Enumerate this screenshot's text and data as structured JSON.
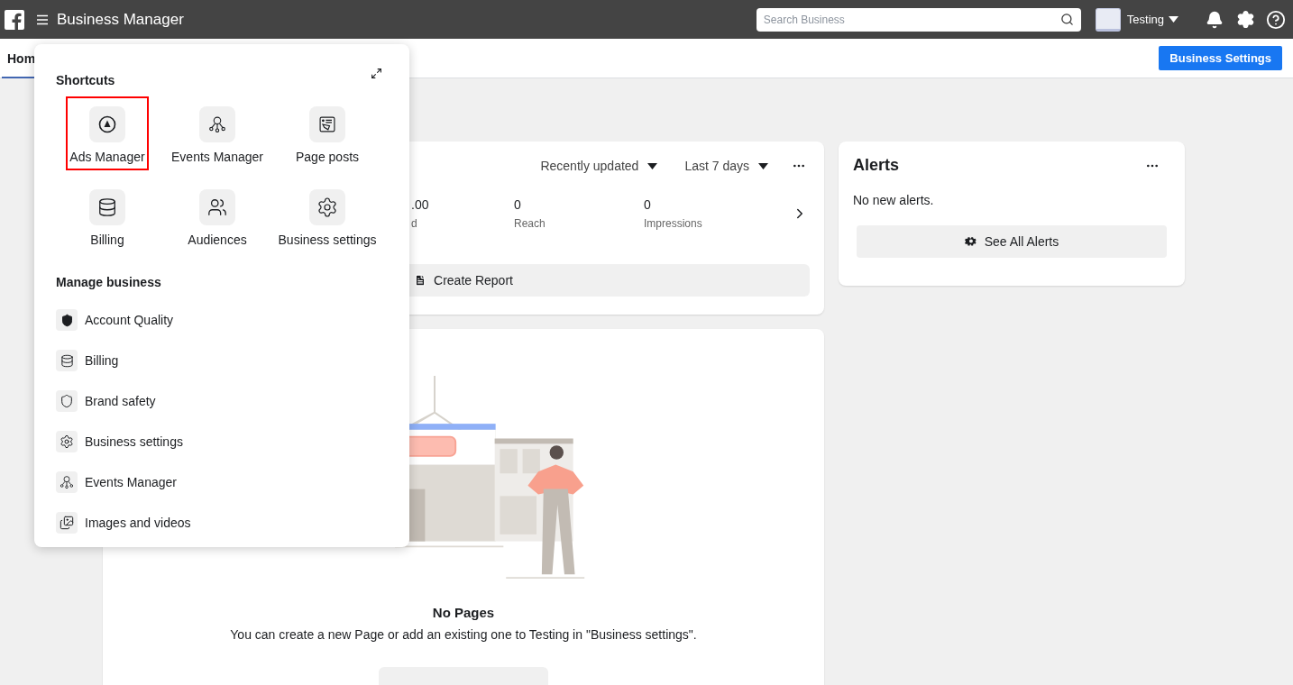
{
  "topbar": {
    "title": "Business Manager",
    "search": {
      "placeholder": "Search Business"
    },
    "account": {
      "name": "Testing"
    }
  },
  "tabs": [
    {
      "label": "Hom",
      "selected": true
    }
  ],
  "header_button": "Business Settings",
  "performance_card": {
    "filters": [
      {
        "label": "Recently updated"
      },
      {
        "label": "Last 7 days"
      }
    ],
    "metrics": [
      {
        "value": ".00",
        "label": "d"
      },
      {
        "value": "0",
        "label": "Reach"
      },
      {
        "value": "0",
        "label": "Impressions"
      }
    ],
    "button": "Create Report"
  },
  "alerts_card": {
    "title": "Alerts",
    "message": "No new alerts.",
    "button": "See All Alerts"
  },
  "pages_card": {
    "title": "No Pages",
    "description": "You can create a new Page or add an existing one to Testing in \"Business settings\"."
  },
  "menu": {
    "shortcuts_title": "Shortcuts",
    "shortcuts": [
      {
        "label": "Ads Manager",
        "highlighted": true
      },
      {
        "label": "Events Manager",
        "highlighted": false
      },
      {
        "label": "Page posts",
        "highlighted": false
      },
      {
        "label": "Billing",
        "highlighted": false
      },
      {
        "label": "Audiences",
        "highlighted": false
      },
      {
        "label": "Business settings",
        "highlighted": false
      }
    ],
    "manage_title": "Manage business",
    "manage_items": [
      {
        "label": "Account Quality"
      },
      {
        "label": "Billing"
      },
      {
        "label": "Brand safety"
      },
      {
        "label": "Business settings"
      },
      {
        "label": "Events Manager"
      },
      {
        "label": "Images and videos"
      }
    ]
  }
}
